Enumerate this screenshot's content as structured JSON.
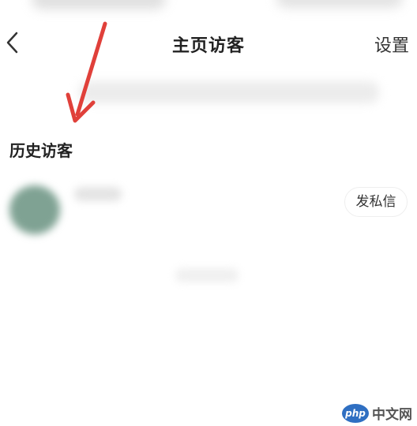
{
  "header": {
    "back_icon": "chevron-left-icon",
    "title": "主页访客",
    "settings_label": "设置"
  },
  "history": {
    "section_title": "历史访客",
    "visitors": [
      {
        "avatar_color": "#7fa293",
        "message_button_label": "发私信"
      }
    ]
  },
  "annotation": {
    "arrow_color": "#e0403a"
  },
  "watermark": {
    "logo_text": "php",
    "site_text": "中文网"
  }
}
